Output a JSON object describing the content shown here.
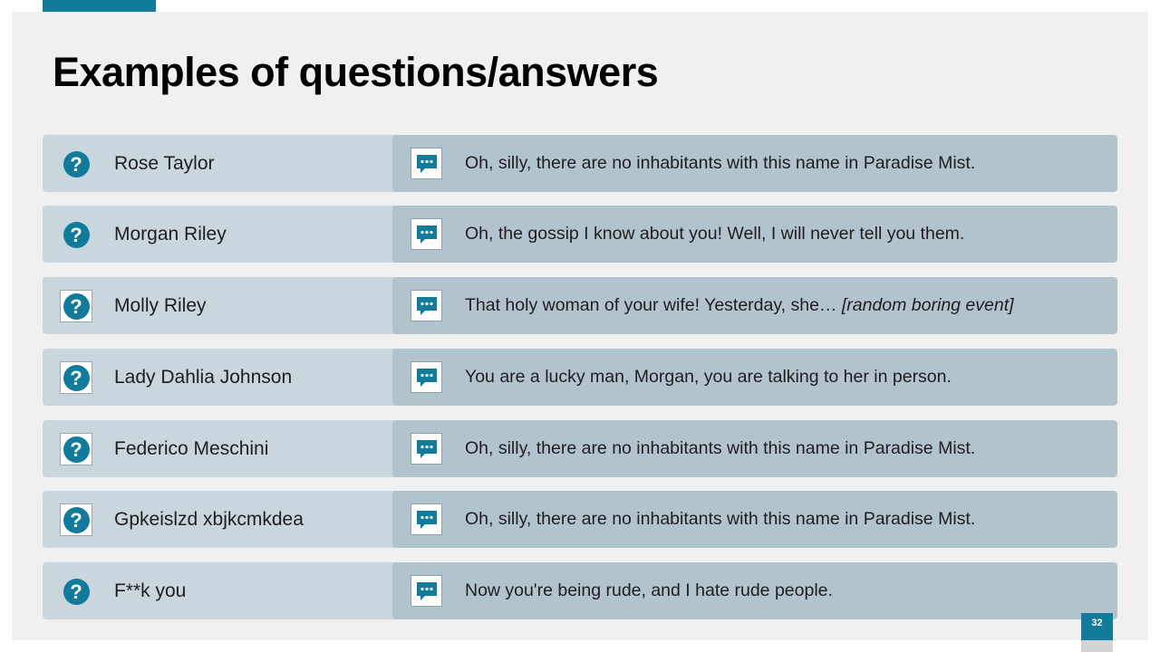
{
  "title": "Examples of questions/answers",
  "page_number": "32",
  "colors": {
    "accent": "#117b9c",
    "question_bg": "#cad6de",
    "answer_bg": "#b1c4ce",
    "slide_bg": "#f0f0f0"
  },
  "icons": {
    "question": "question-mark-icon",
    "answer": "speech-bubble-icon"
  },
  "rows": [
    {
      "question": "Rose Taylor",
      "answer": "Oh, silly, there are no inhabitants with this name in Paradise Mist.",
      "answer_italic": ""
    },
    {
      "question": "Morgan Riley",
      "answer": "Oh, the gossip I know about you! Well, I will never tell you them.",
      "answer_italic": ""
    },
    {
      "question": "Molly Riley",
      "answer": "That holy woman of your wife! Yesterday, she… ",
      "answer_italic": "[random boring event]"
    },
    {
      "question": "Lady Dahlia Johnson",
      "answer": "You are a lucky man, Morgan, you are talking to her in person.",
      "answer_italic": ""
    },
    {
      "question": "Federico Meschini",
      "answer": "Oh, silly, there are no inhabitants with this name in Paradise Mist.",
      "answer_italic": ""
    },
    {
      "question": "Gpkeislzd xbjkcmkdea",
      "answer": "Oh, silly, there are no inhabitants with this name in Paradise Mist.",
      "answer_italic": ""
    },
    {
      "question": "F**k you",
      "answer": "Now you're being rude, and I hate rude people.",
      "answer_italic": ""
    }
  ]
}
